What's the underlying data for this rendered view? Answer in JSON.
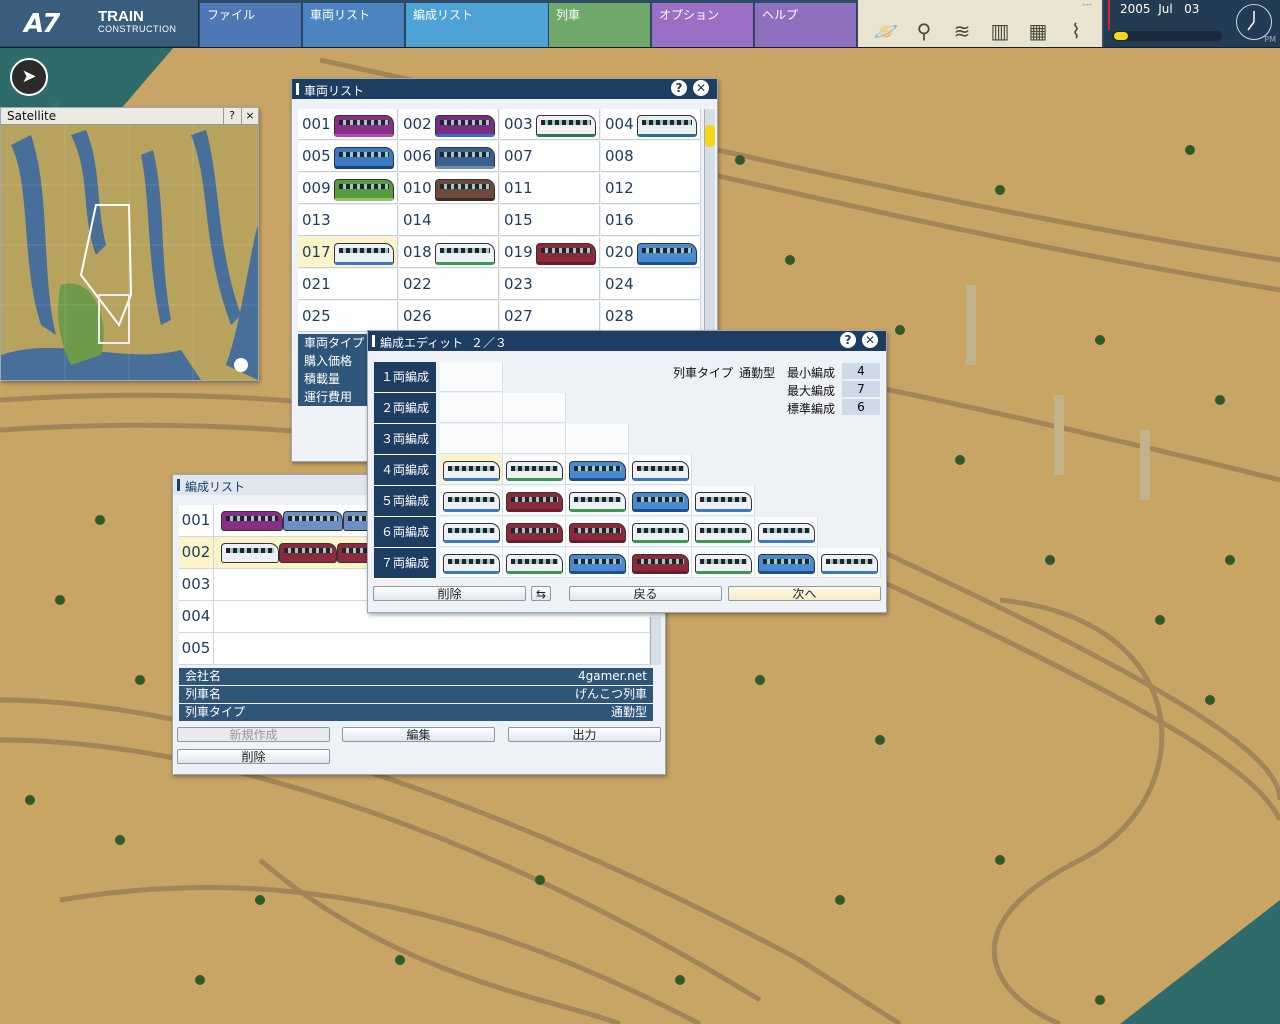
{
  "app": {
    "logo_mark": "A7",
    "logo_title": "TRAIN",
    "logo_subtitle": "CONSTRUCTION"
  },
  "menu": [
    "ファイル",
    "車両リスト",
    "編成リスト",
    "列車",
    "オプション",
    "ヘルプ"
  ],
  "menu_colors": [
    "#4d78b5",
    "#4b84c0",
    "#4fa2d6",
    "#6ea86a",
    "#9a6ec4",
    "#8e6fc0"
  ],
  "tools": [
    "planet-icon",
    "magnifier-icon",
    "layers-icon",
    "buildings-icon",
    "grid-icon",
    "rail-icon"
  ],
  "tools_indicator": "---",
  "datetime": {
    "year": "2005",
    "month": "Jul",
    "day": "03",
    "ampm": "PM"
  },
  "satellite": {
    "title": "Satellite",
    "help": "?",
    "close": "×"
  },
  "vehicle_list": {
    "title": "車両リスト",
    "cells": [
      {
        "no": "001",
        "color": "#8a2f86",
        "stripe": "#b04bb0"
      },
      {
        "no": "002",
        "color": "#7a2c85",
        "stripe": "#3a6ec4"
      },
      {
        "no": "003",
        "color": "#f2f2f2",
        "stripe": "#2a7a5a"
      },
      {
        "no": "004",
        "color": "#e8eef2",
        "stripe": "#2a6e8e"
      },
      {
        "no": "005",
        "color": "#3a7ac4",
        "stripe": "#1c3f70"
      },
      {
        "no": "006",
        "color": "#3b5f8e",
        "stripe": "#6e8fb0"
      },
      {
        "no": "007",
        "color": "",
        "stripe": ""
      },
      {
        "no": "008",
        "color": "",
        "stripe": ""
      },
      {
        "no": "009",
        "color": "#5a9a3e",
        "stripe": "#8ec46a"
      },
      {
        "no": "010",
        "color": "#6e4a3a",
        "stripe": "#3a2a22"
      },
      {
        "no": "011",
        "color": "",
        "stripe": ""
      },
      {
        "no": "012",
        "color": "",
        "stripe": ""
      },
      {
        "no": "013",
        "color": "",
        "stripe": ""
      },
      {
        "no": "014",
        "color": "",
        "stripe": ""
      },
      {
        "no": "015",
        "color": "",
        "stripe": ""
      },
      {
        "no": "016",
        "color": "",
        "stripe": ""
      },
      {
        "no": "017",
        "color": "#eef2f6",
        "stripe": "#3a7ac4"
      },
      {
        "no": "018",
        "color": "#eef2f6",
        "stripe": "#3a9a4e"
      },
      {
        "no": "019",
        "color": "#8a2a3a",
        "stripe": "#6a1e2a"
      },
      {
        "no": "020",
        "color": "#4a8ad0",
        "stripe": "#1c4f90"
      },
      {
        "no": "021",
        "color": "",
        "stripe": ""
      },
      {
        "no": "022",
        "color": "",
        "stripe": ""
      },
      {
        "no": "023",
        "color": "",
        "stripe": ""
      },
      {
        "no": "024",
        "color": "",
        "stripe": ""
      },
      {
        "no": "025",
        "color": "",
        "stripe": ""
      },
      {
        "no": "026",
        "color": "",
        "stripe": ""
      },
      {
        "no": "027",
        "color": "",
        "stripe": ""
      },
      {
        "no": "028",
        "color": "",
        "stripe": ""
      }
    ],
    "props": [
      "車両タイプ",
      "購入価格",
      "積載量",
      "運行費用"
    ]
  },
  "formation_edit": {
    "title": "編成エディット",
    "page": "２／３",
    "train_type_label": "列車タイプ",
    "train_type": "通勤型",
    "min_label": "最小編成",
    "min": "4",
    "max_label": "最大編成",
    "max": "7",
    "std_label": "標準編成",
    "std": "6",
    "rows": [
      {
        "label": "１両編成",
        "cars": []
      },
      {
        "label": "２両編成",
        "cars": []
      },
      {
        "label": "３両編成",
        "cars": []
      },
      {
        "label": "４両編成",
        "cars": [
          "017",
          "018",
          "020",
          "017"
        ]
      },
      {
        "label": "５両編成",
        "cars": [
          "017",
          "019",
          "018",
          "020",
          "017"
        ]
      },
      {
        "label": "６両編成",
        "cars": [
          "017",
          "019",
          "019",
          "018",
          "018",
          "017"
        ]
      },
      {
        "label": "７両編成",
        "cars": [
          "017",
          "018",
          "020",
          "019",
          "018",
          "020",
          "017"
        ]
      }
    ],
    "buttons": {
      "delete": "削除",
      "swap": "⇆",
      "back": "戻る",
      "next": "次へ"
    }
  },
  "formation_list": {
    "title": "編成リスト",
    "rows": [
      "001",
      "002",
      "003",
      "004",
      "005"
    ],
    "props": [
      {
        "k": "会社名",
        "v": "4gamer.net"
      },
      {
        "k": "列車名",
        "v": "げんこつ列車"
      },
      {
        "k": "列車タイプ",
        "v": "通勤型"
      }
    ],
    "buttons": {
      "new": "新規作成",
      "edit": "編集",
      "output": "出力",
      "delete": "削除"
    }
  }
}
